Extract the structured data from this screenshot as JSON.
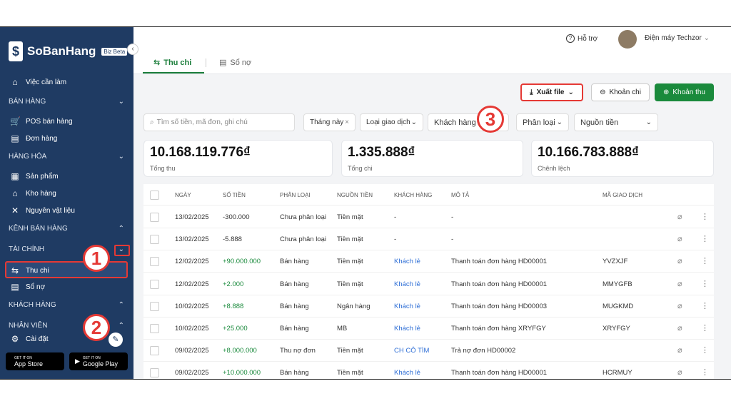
{
  "sidebar": {
    "logo_text": "SoBanHang",
    "logo_badge": "Biz Beta",
    "items": [
      {
        "label": "Việc cần làm",
        "icon": "home-icon"
      },
      {
        "label": "POS bán hàng",
        "icon": "cart-icon"
      },
      {
        "label": "Đơn hàng",
        "icon": "document-icon"
      },
      {
        "label": "Sản phẩm",
        "icon": "box-icon"
      },
      {
        "label": "Kho hàng",
        "icon": "warehouse-icon"
      },
      {
        "label": "Nguyên vật liệu",
        "icon": "tools-icon"
      },
      {
        "label": "Thu chi",
        "icon": "transfer-icon"
      },
      {
        "label": "Sổ nợ",
        "icon": "ledger-icon"
      },
      {
        "label": "Cài đặt",
        "icon": "gear-icon"
      }
    ],
    "sections": [
      "BÁN HÀNG",
      "HÀNG HÓA",
      "KÊNH BÁN HÀNG",
      "TÀI CHÍNH",
      "KHÁCH HÀNG",
      "NHÂN VIÊN"
    ],
    "app_store": {
      "small": "GET IT ON",
      "label": "App Store"
    },
    "google_play": {
      "small": "GET IT ON",
      "label": "Google Play"
    }
  },
  "annotations": [
    "1",
    "2",
    "3"
  ],
  "topbar": {
    "help": "Hỗ trợ",
    "store_name": "Điện máy Techzor"
  },
  "tabs": [
    "Thu chi",
    "Sổ nợ"
  ],
  "actions": {
    "export": "Xuất file",
    "expense": "Khoản chi",
    "income": "Khoản thu"
  },
  "search": {
    "placeholder": "Tìm số tiền, mã đơn, ghi chú"
  },
  "filters": {
    "month": "Tháng này",
    "type": "Loại giao dịch",
    "customer": "Khách hàng",
    "category": "Phân loại",
    "source": "Nguồn tiền"
  },
  "stats": [
    {
      "value": "10.168.119.776₫",
      "label": "Tổng thu"
    },
    {
      "value": "1.335.888₫",
      "label": "Tổng chi"
    },
    {
      "value": "10.166.783.888₫",
      "label": "Chênh lệch"
    }
  ],
  "table": {
    "headers": [
      "NGÀY",
      "SỐ TIỀN",
      "PHÂN LOẠI",
      "NGUỒN TIỀN",
      "KHÁCH HÀNG",
      "MÔ TẢ",
      "MÃ GIAO DỊCH"
    ],
    "rows": [
      {
        "date": "13/02/2025",
        "amount": "-300.000",
        "category": "Chưa phân loại",
        "source": "Tiền mặt",
        "customer": "-",
        "desc": "-",
        "code": ""
      },
      {
        "date": "13/02/2025",
        "amount": "-5.888",
        "category": "Chưa phân loại",
        "source": "Tiền mặt",
        "customer": "-",
        "desc": "-",
        "code": ""
      },
      {
        "date": "12/02/2025",
        "amount": "+90.000.000",
        "category": "Bán hàng",
        "source": "Tiền mặt",
        "customer": "Khách lẻ",
        "desc": "Thanh toán đơn hàng HD00001",
        "code": "YVZXJF"
      },
      {
        "date": "12/02/2025",
        "amount": "+2.000",
        "category": "Bán hàng",
        "source": "Tiền mặt",
        "customer": "Khách lẻ",
        "desc": "Thanh toán đơn hàng HD00001",
        "code": "MMYGFB"
      },
      {
        "date": "10/02/2025",
        "amount": "+8.888",
        "category": "Bán hàng",
        "source": "Ngân hàng",
        "customer": "Khách lẻ",
        "desc": "Thanh toán đơn hàng HD00003",
        "code": "MUGKMD"
      },
      {
        "date": "10/02/2025",
        "amount": "+25.000",
        "category": "Bán hàng",
        "source": "MB",
        "customer": "Khách lẻ",
        "desc": "Thanh toán đơn hàng XRYFGY",
        "code": "XRYFGY"
      },
      {
        "date": "09/02/2025",
        "amount": "+8.000.000",
        "category": "Thu nợ đơn",
        "source": "Tiền mặt",
        "customer": "CH CÔ TÌM",
        "desc": "Trả nợ đơn HD00002",
        "code": ""
      },
      {
        "date": "09/02/2025",
        "amount": "+10.000.000",
        "category": "Bán hàng",
        "source": "Tiền mặt",
        "customer": "Khách lẻ",
        "desc": "Thanh toán đơn hàng HD00001",
        "code": "HCRMUY"
      }
    ]
  }
}
